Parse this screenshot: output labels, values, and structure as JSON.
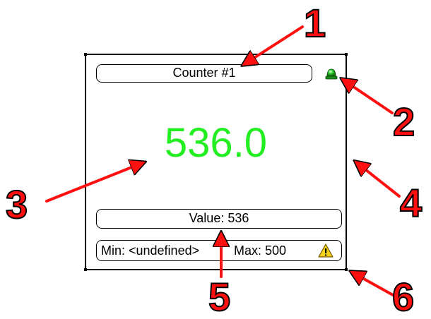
{
  "widget": {
    "title": "Counter #1",
    "display_value": "536.0",
    "value_line": "Value: 536",
    "min_label": "Min: <undefined>",
    "max_label": "Max: 500",
    "led_icon": "green-led-icon",
    "warning_icon": "warning-icon",
    "value_color": "#22ee22"
  },
  "callouts": {
    "c1": "1",
    "c2": "2",
    "c3": "3",
    "c4": "4",
    "c5": "5",
    "c6": "6",
    "color": "#ff1010"
  }
}
